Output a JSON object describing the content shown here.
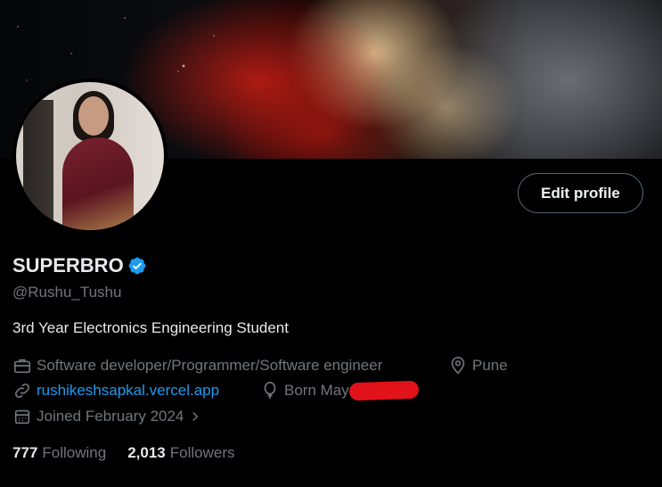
{
  "profile": {
    "edit_label": "Edit profile",
    "name": "SUPERBRO",
    "handle": "@Rushu_Tushu",
    "bio": "3rd Year Electronics Engineering Student",
    "job": "Software developer/Programmer/Software engineer",
    "location": "Pune",
    "website": "rushikeshsapkal.vercel.app",
    "born": "Born May",
    "joined": "Joined February 2024"
  },
  "stats": {
    "following_count": "777",
    "following_label": "Following",
    "followers_count": "2,013",
    "followers_label": "Followers"
  },
  "colors": {
    "accent": "#1d9bf0",
    "redaction": "#e2121a"
  },
  "icons": {
    "verified": "verified-badge-icon",
    "job": "briefcase-icon",
    "location": "location-pin-icon",
    "website": "link-icon",
    "born": "balloon-icon",
    "joined": "calendar-icon",
    "chevron": "chevron-right-icon"
  }
}
